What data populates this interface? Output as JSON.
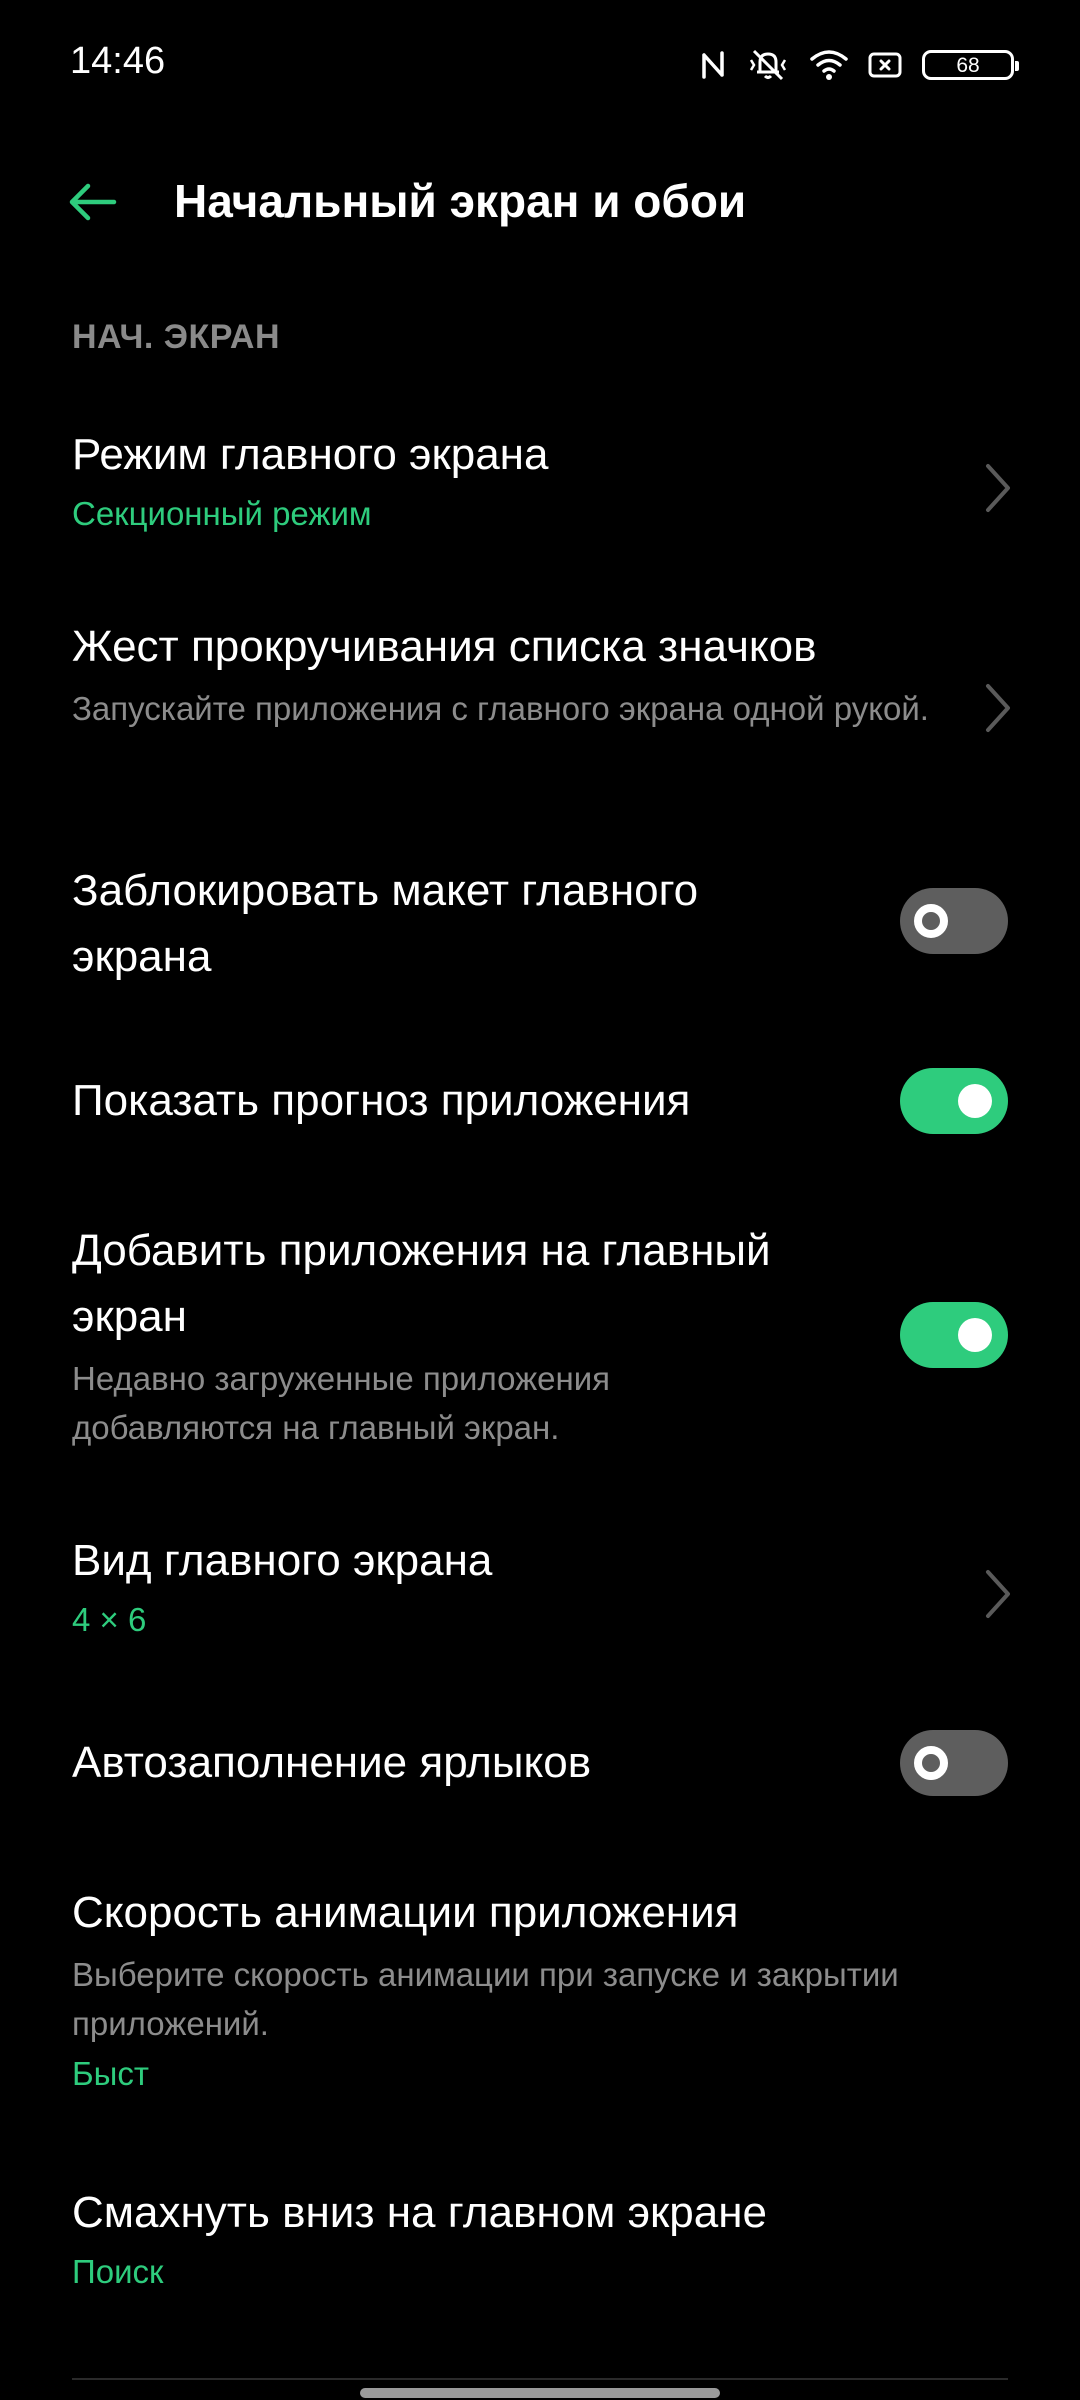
{
  "status_bar": {
    "time": "14:46",
    "battery_level": "68",
    "icons": [
      "nfc-icon",
      "vibrate-icon",
      "wifi-icon",
      "cast-icon",
      "battery-icon"
    ]
  },
  "app_bar": {
    "back_icon": "arrow-left-icon",
    "title": "Начальный экран и обои"
  },
  "section": {
    "header": "НАЧ. ЭКРАН"
  },
  "settings": {
    "home_mode": {
      "title": "Режим главного экрана",
      "value": "Секционный режим"
    },
    "scroll_gesture": {
      "title": "Жест прокручивания списка значков",
      "subtitle": "Запускайте приложения с главного экрана одной рукой."
    },
    "lock_layout": {
      "title": "Заблокировать макет главного экрана",
      "enabled": false
    },
    "app_suggestions": {
      "title": "Показать прогноз приложения",
      "enabled": true
    },
    "add_apps": {
      "title": "Добавить приложения на главный экран",
      "subtitle": "Недавно загруженные приложения добавляются на главный экран.",
      "enabled": true
    },
    "home_view": {
      "title": "Вид главного экрана",
      "value": "4 × 6"
    },
    "autofill_shortcuts": {
      "title": "Автозаполнение ярлыков",
      "enabled": false
    },
    "animation_speed": {
      "title": "Скорость анимации приложения",
      "subtitle": "Выберите скорость анимации при запуске и закрытии приложений.",
      "value": "Быст"
    },
    "swipe_down": {
      "title": "Смахнуть вниз на главном экране",
      "value": "Поиск"
    }
  },
  "colors": {
    "accent": "#2ecc7d",
    "background": "#000000",
    "toggle_off": "#5e5e5e",
    "secondary_text": "#8c8c8c"
  }
}
